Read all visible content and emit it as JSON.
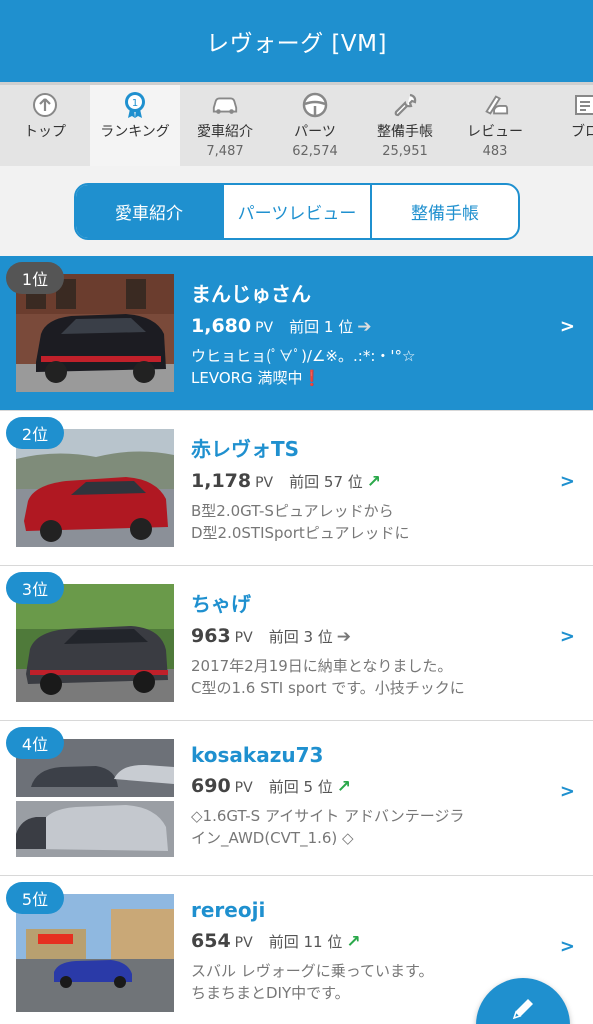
{
  "header": {
    "title": "レヴォーグ [VM]"
  },
  "nav": {
    "items": [
      {
        "label": "トップ",
        "count": "",
        "icon": "top-icon"
      },
      {
        "label": "ランキング",
        "count": "",
        "icon": "ranking-medal-icon"
      },
      {
        "label": "愛車紹介",
        "count": "7,487",
        "icon": "car-icon"
      },
      {
        "label": "パーツ",
        "count": "62,574",
        "icon": "steering-wheel-icon"
      },
      {
        "label": "整備手帳",
        "count": "25,951",
        "icon": "wrench-icon"
      },
      {
        "label": "レビュー",
        "count": "483",
        "icon": "review-pen-icon"
      },
      {
        "label": "ブロ",
        "count": "",
        "icon": "blog-icon"
      }
    ]
  },
  "segments": {
    "items": [
      "愛車紹介",
      "パーツレビュー",
      "整備手帳"
    ],
    "active": 0
  },
  "ranking": [
    {
      "rank": "1位",
      "name": "まんじゅさん",
      "pv": "1,680",
      "pv_unit": "PV",
      "prev": "前回 1 位",
      "trend": "same",
      "line1": "ウヒョヒョ(ﾟ∀ﾟ)/∠※。.:*:・'°☆",
      "line2": "LEVORG 満喫中",
      "exclaim": "❗"
    },
    {
      "rank": "2位",
      "name": "赤レヴォTS",
      "pv": "1,178",
      "pv_unit": "PV",
      "prev": "前回 57 位",
      "trend": "up",
      "line1": "B型2.0GT-Sピュアレッドから",
      "line2": "D型2.0STISportピュアレッドに",
      "exclaim": ""
    },
    {
      "rank": "3位",
      "name": "ちゃげ",
      "pv": "963",
      "pv_unit": "PV",
      "prev": "前回 3 位",
      "trend": "same",
      "line1": "2017年2月19日に納車となりました。",
      "line2": "C型の1.6 STI sport です。小技チックに",
      "exclaim": ""
    },
    {
      "rank": "4位",
      "name": "kosakazu73",
      "pv": "690",
      "pv_unit": "PV",
      "prev": "前回 5 位",
      "trend": "up",
      "line1": "◇1.6GT-S アイサイト アドバンテージラ",
      "line2": "イン_AWD(CVT_1.6) ◇",
      "exclaim": ""
    },
    {
      "rank": "5位",
      "name": "rereoji",
      "pv": "654",
      "pv_unit": "PV",
      "prev": "前回 11 位",
      "trend": "up",
      "line1": "スバル レヴォーグに乗っています。",
      "line2": "ちまちまとDIY中です。",
      "exclaim": ""
    }
  ],
  "arrows": {
    "same": "➔",
    "up": "↗",
    "chevron": ">"
  },
  "colors": {
    "brand": "#1f90cf",
    "up": "#2aa84a",
    "exclaim": "#e02020"
  }
}
